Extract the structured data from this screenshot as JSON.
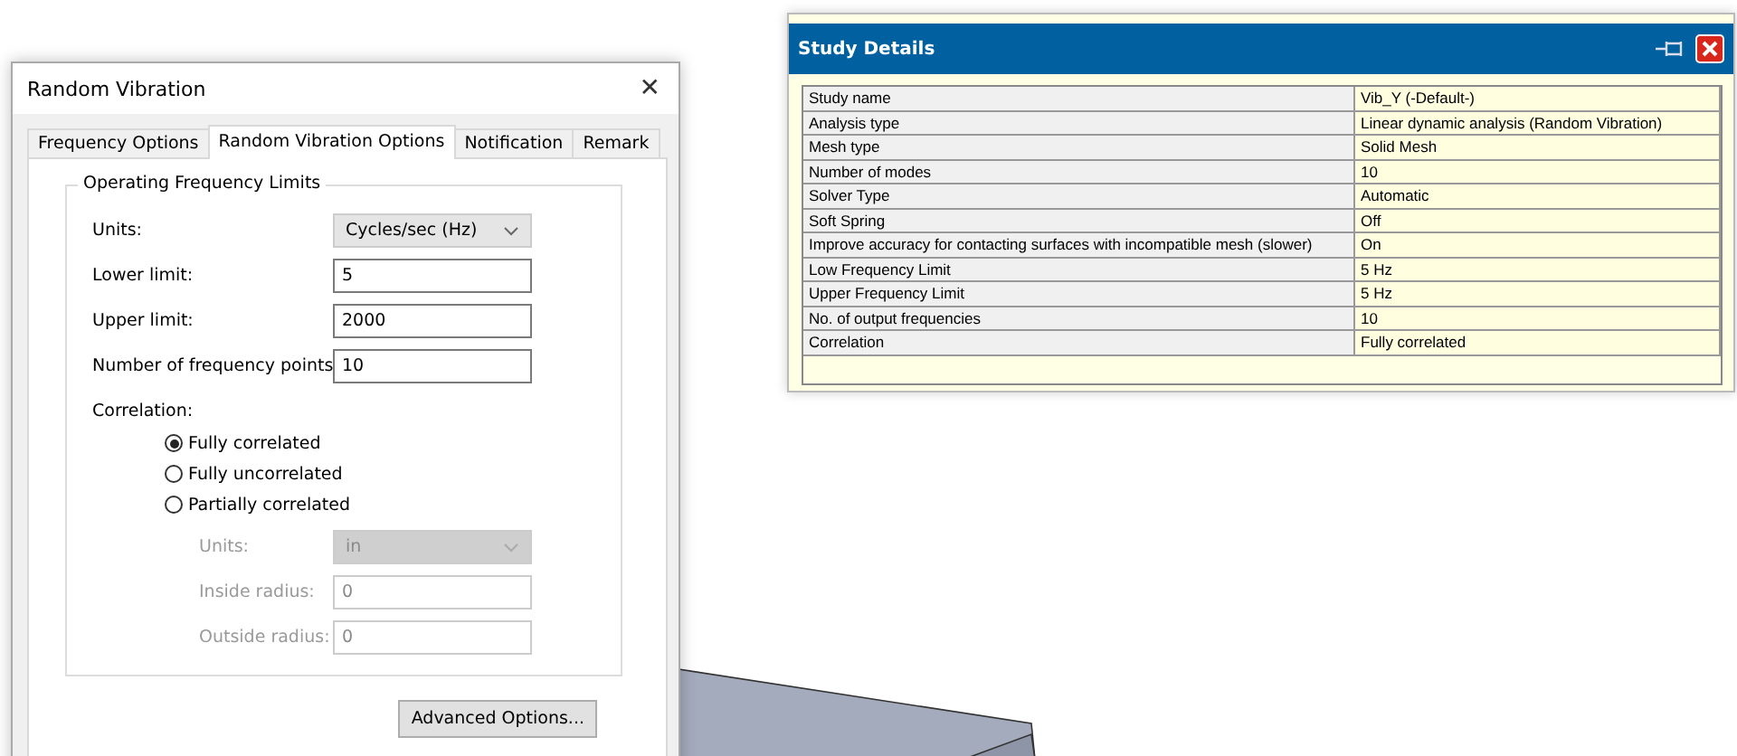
{
  "dialog": {
    "title": "Random Vibration",
    "close_glyph": "✕",
    "tabs": [
      {
        "label": "Frequency Options",
        "selected": false
      },
      {
        "label": "Random Vibration Options",
        "selected": true
      },
      {
        "label": "Notification",
        "selected": false
      },
      {
        "label": "Remark",
        "selected": false
      }
    ],
    "group": {
      "title": "Operating Frequency Limits",
      "fields": [
        {
          "kind": "select",
          "label": "Units:",
          "value": "Cycles/sec (Hz)",
          "disabled": false
        },
        {
          "kind": "input",
          "label": "Lower limit:",
          "value": "5",
          "disabled": false
        },
        {
          "kind": "input",
          "label": "Upper limit:",
          "value": "2000",
          "disabled": false
        },
        {
          "kind": "input",
          "label": "Number of frequency points",
          "value": "10",
          "disabled": false
        }
      ],
      "correlation_label": "Correlation:",
      "correlation_options": [
        {
          "label": "Fully correlated",
          "selected": true
        },
        {
          "label": "Fully uncorrelated",
          "selected": false
        },
        {
          "label": "Partially correlated",
          "selected": false
        }
      ],
      "partial_fields": [
        {
          "kind": "select",
          "label": "Units:",
          "value": "in",
          "disabled": true
        },
        {
          "kind": "input",
          "label": "Inside radius:",
          "value": "0",
          "disabled": true
        },
        {
          "kind": "input",
          "label": "Outside radius:",
          "value": "0",
          "disabled": true
        }
      ]
    },
    "button": "Advanced Options..."
  },
  "study_details": {
    "title": "Study Details",
    "rows": [
      {
        "name": "Study name",
        "value": "Vib_Y (-Default-)"
      },
      {
        "name": "Analysis type",
        "value": "Linear dynamic analysis (Random Vibration)"
      },
      {
        "name": "Mesh type",
        "value": "Solid Mesh"
      },
      {
        "name": "Number of modes",
        "value": "10"
      },
      {
        "name": "Solver Type",
        "value": "Automatic"
      },
      {
        "name": "Soft Spring",
        "value": "Off"
      },
      {
        "name": "Improve accuracy for contacting surfaces with incompatible mesh (slower)",
        "value": "On"
      },
      {
        "name": "Low Frequency Limit",
        "value": "5 Hz"
      },
      {
        "name": "Upper Frequency Limit",
        "value": "5 Hz"
      },
      {
        "name": "No. of output frequencies",
        "value": "10"
      },
      {
        "name": "Correlation",
        "value": "Fully correlated"
      }
    ]
  }
}
